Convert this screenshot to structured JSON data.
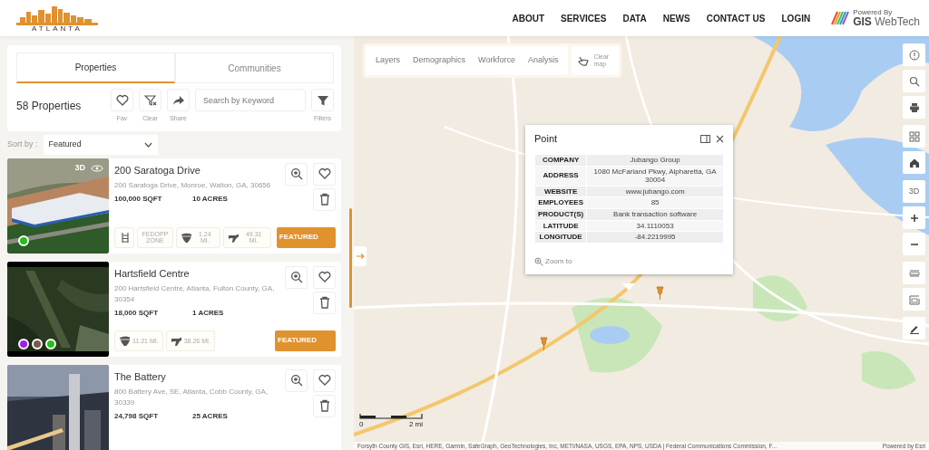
{
  "header": {
    "logo_text": "ATLANTA",
    "nav": [
      {
        "label": "ABOUT"
      },
      {
        "label": "SERVICES"
      },
      {
        "label": "DATA"
      },
      {
        "label": "NEWS"
      },
      {
        "label": "CONTACT US"
      },
      {
        "label": "LOGIN"
      }
    ],
    "powered": {
      "small": "Powered By",
      "brand_bold": "GIS",
      "brand": "WebTech"
    }
  },
  "panel": {
    "tabs": [
      {
        "label": "Properties",
        "selected": true
      },
      {
        "label": "Communities",
        "selected": false
      }
    ],
    "count": "58 Properties",
    "tools": [
      {
        "kind": "fav",
        "label": "Fav"
      },
      {
        "kind": "clear",
        "label": "Clear"
      },
      {
        "kind": "share",
        "label": "Share"
      }
    ],
    "search": {
      "placeholder": "Search by Keyword"
    },
    "filters": {
      "label": "Filters"
    },
    "sort": {
      "label": "Sort by :",
      "value": "Featured"
    }
  },
  "properties": [
    {
      "name": "200 Saratoga Drive",
      "address": "200 Saratoga Drive, Monroe, Walton, GA, 30656",
      "sqft": "100,000 SQFT",
      "acres": "10 ACRES",
      "badge_3d": "3D",
      "markers": [
        {
          "color": "#22c11a"
        }
      ],
      "chips": [
        {
          "kind": "rail"
        },
        {
          "kind": "zone",
          "label": "FEDOPP ZONE"
        },
        {
          "kind": "highway",
          "label": "1.24 MI."
        },
        {
          "kind": "airport",
          "label": "49.31 MI."
        }
      ],
      "featured": "FEATURED"
    },
    {
      "name": "Hartsfield Centre",
      "address": "200 Hartsfield Centre, Atlanta, Fulton County, GA, 30354",
      "sqft": "18,000 SQFT",
      "acres": "1 ACRES",
      "markers": [
        {
          "color": "#9b1ff0"
        },
        {
          "color": "#7a5a48"
        },
        {
          "color": "#22c11a"
        }
      ],
      "chips": [
        {
          "kind": "highway",
          "label": "11.21 MI."
        },
        {
          "kind": "airport",
          "label": "38.26 MI."
        }
      ],
      "featured": "FEATURED"
    },
    {
      "name": "The Battery",
      "address": "800 Battery Ave, SE, Atlanta, Cobb County, GA, 30339",
      "sqft": "24,798 SQFT",
      "acres": "25 ACRES"
    }
  ],
  "map": {
    "tabs": [
      {
        "label": "Layers"
      },
      {
        "label": "Demographics"
      },
      {
        "label": "Workforce"
      },
      {
        "label": "Analysis"
      }
    ],
    "clear": "Clear map",
    "popup": {
      "title": "Point",
      "rows": [
        {
          "label": "COMPANY",
          "value": "Jubango Group"
        },
        {
          "label": "ADDRESS",
          "value": "1080 McFarland Pkwy, Alpharetta, GA 30004"
        },
        {
          "label": "WEBSITE",
          "value": "www.jubango.com"
        },
        {
          "label": "EMPLOYEES",
          "value": "85"
        },
        {
          "label": "PRODUCT(S)",
          "value": "Bank transaction software"
        },
        {
          "label": "LATITUDE",
          "value": "34.1110053"
        },
        {
          "label": "LONGITUDE",
          "value": "-84.2219995"
        }
      ],
      "zoom": "Zoom to"
    },
    "tools": [
      {
        "kind": "info"
      },
      {
        "kind": "search"
      },
      {
        "kind": "print"
      },
      {
        "kind": "grid"
      },
      {
        "kind": "home"
      },
      {
        "kind": "text",
        "label": "3D"
      },
      {
        "kind": "plus"
      },
      {
        "kind": "minus"
      },
      {
        "kind": "ruler"
      },
      {
        "kind": "area"
      },
      {
        "kind": "edit"
      }
    ],
    "scale": {
      "start": "0",
      "end": "2 mi"
    },
    "attribution": "Forsyth County GIS, Esri, HERE, Garmin, SafeGraph, GeoTechnologies, Inc, METI/NASA, USGS, EPA, NPS, USDA | Federal Communications Commission, F...",
    "powered": "Powered by Esri"
  }
}
